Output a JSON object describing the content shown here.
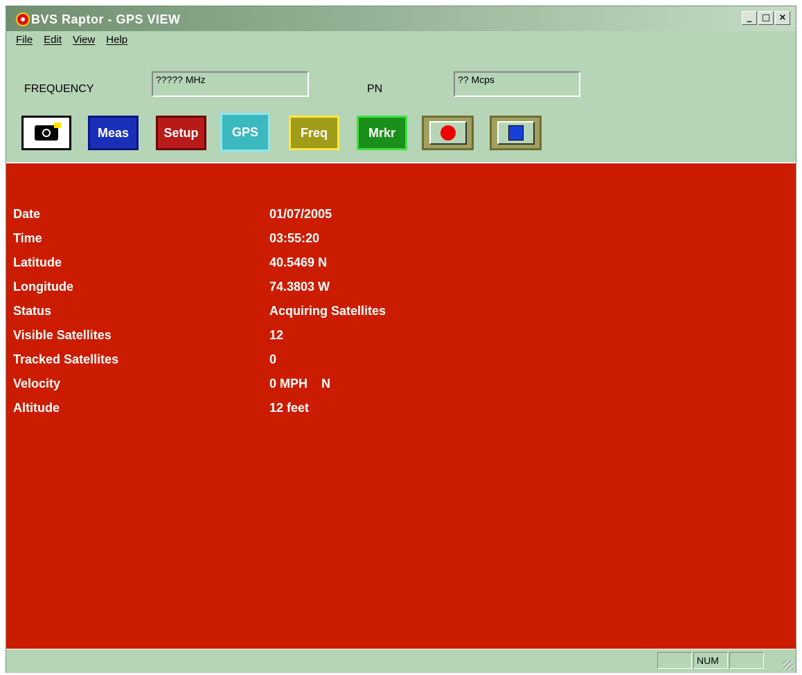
{
  "window": {
    "title": "BVS Raptor - GPS VIEW",
    "min": "_",
    "max": "□",
    "close": "×"
  },
  "menu": {
    "file": "File",
    "edit": "Edit",
    "view": "View",
    "help": "Help"
  },
  "freq": {
    "label": "FREQUENCY",
    "value": "????? MHz",
    "pn_label": "PN",
    "pn_value": "?? Mcps"
  },
  "toolbar": {
    "meas": "Meas",
    "setup": "Setup",
    "gps": "GPS",
    "freq": "Freq",
    "mrkr": "Mrkr"
  },
  "gps": {
    "rows": [
      {
        "label": "Date",
        "value": "01/07/2005"
      },
      {
        "label": "Time",
        "value": "03:55:20"
      },
      {
        "label": "Latitude",
        "value": "40.5469 N"
      },
      {
        "label": "Longitude",
        "value": "74.3803 W"
      },
      {
        "label": "Status",
        "value": "Acquiring Satellites"
      },
      {
        "label": "Visible Satellites",
        "value": "12"
      },
      {
        "label": "Tracked Satellites",
        "value": "0"
      },
      {
        "label": "Velocity",
        "value": "0 MPH    N"
      },
      {
        "label": "Altitude",
        "value": "12 feet"
      }
    ]
  },
  "status": {
    "num": "NUM"
  }
}
